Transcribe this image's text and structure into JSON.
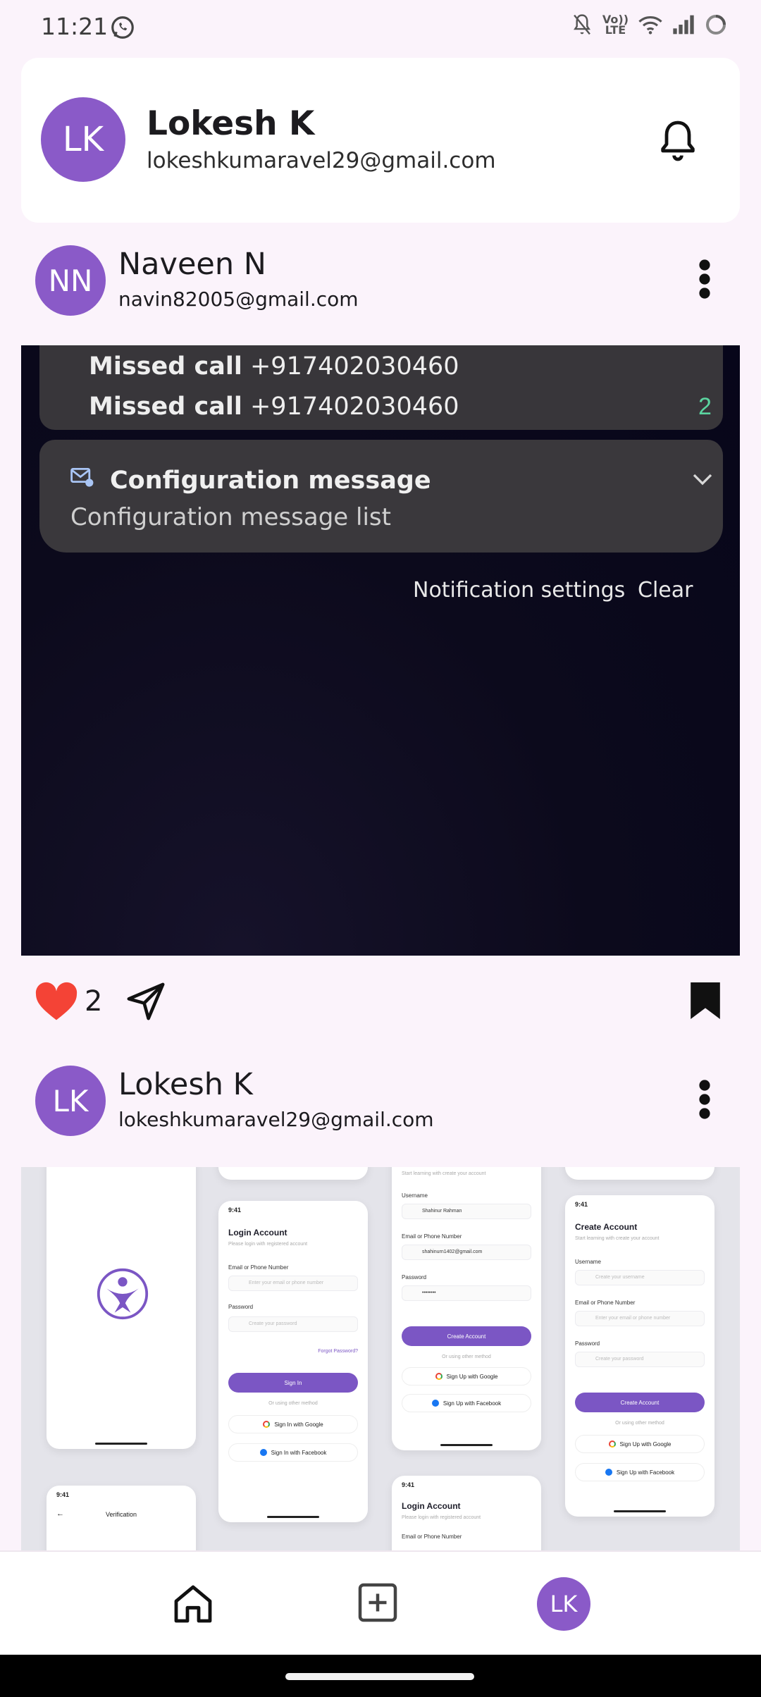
{
  "status_bar": {
    "time": "11:21",
    "volte_line1": "Vo))",
    "volte_line2": "LTE",
    "icons": [
      "whatsapp-icon",
      "bell-muted-icon",
      "volte-icon",
      "wifi-icon",
      "signal-icon",
      "loading-icon"
    ]
  },
  "profile": {
    "initials": "LK",
    "name": "Lokesh K",
    "email": "lokeshkumaravel29@gmail.com"
  },
  "posts": [
    {
      "initials": "NN",
      "name": "Naveen N",
      "email": "navin82005@gmail.com",
      "image": {
        "missed_call_label": "Missed call",
        "missed_calls": [
          "+917402030460",
          "+917402030460"
        ],
        "missed_count": "2",
        "config_title": "Configuration message",
        "config_subtitle": "Configuration message list",
        "notification_settings": "Notification settings",
        "clear": "Clear"
      },
      "likes": "2"
    },
    {
      "initials": "LK",
      "name": "Lokesh K",
      "email": "lokeshkumaravel29@gmail.com",
      "image": {
        "time": "9:41",
        "login_title": "Login Account",
        "login_subtitle": "Please login with registered account",
        "email_or_phone_label": "Email or Phone Number",
        "email_placeholder": "Enter your email or phone number",
        "password_label": "Password",
        "password_placeholder": "Create your password",
        "forgot_password": "Forgot Password?",
        "sign_in": "Sign In",
        "other_method": "Or using other method",
        "sign_in_google": "Sign In with Google",
        "sign_in_facebook": "Sign In with Facebook",
        "create_title": "Create Account",
        "create_subtitle": "Start learning with create your account",
        "username_label": "Username",
        "username_value": "Shahinur Rahman",
        "username_placeholder": "Create your username",
        "email_value": "shahinurn1402@gmail.com",
        "password_value": "••••••••",
        "create_account": "Create Account",
        "sign_up_google": "Sign Up with Google",
        "sign_up_facebook": "Sign Up with Facebook",
        "verification": "Verification"
      }
    }
  ],
  "nav": {
    "avatar_initials": "LK"
  },
  "colors": {
    "accent": "#8a5ac8",
    "background": "#fbf3fb",
    "heart": "#f44336"
  }
}
